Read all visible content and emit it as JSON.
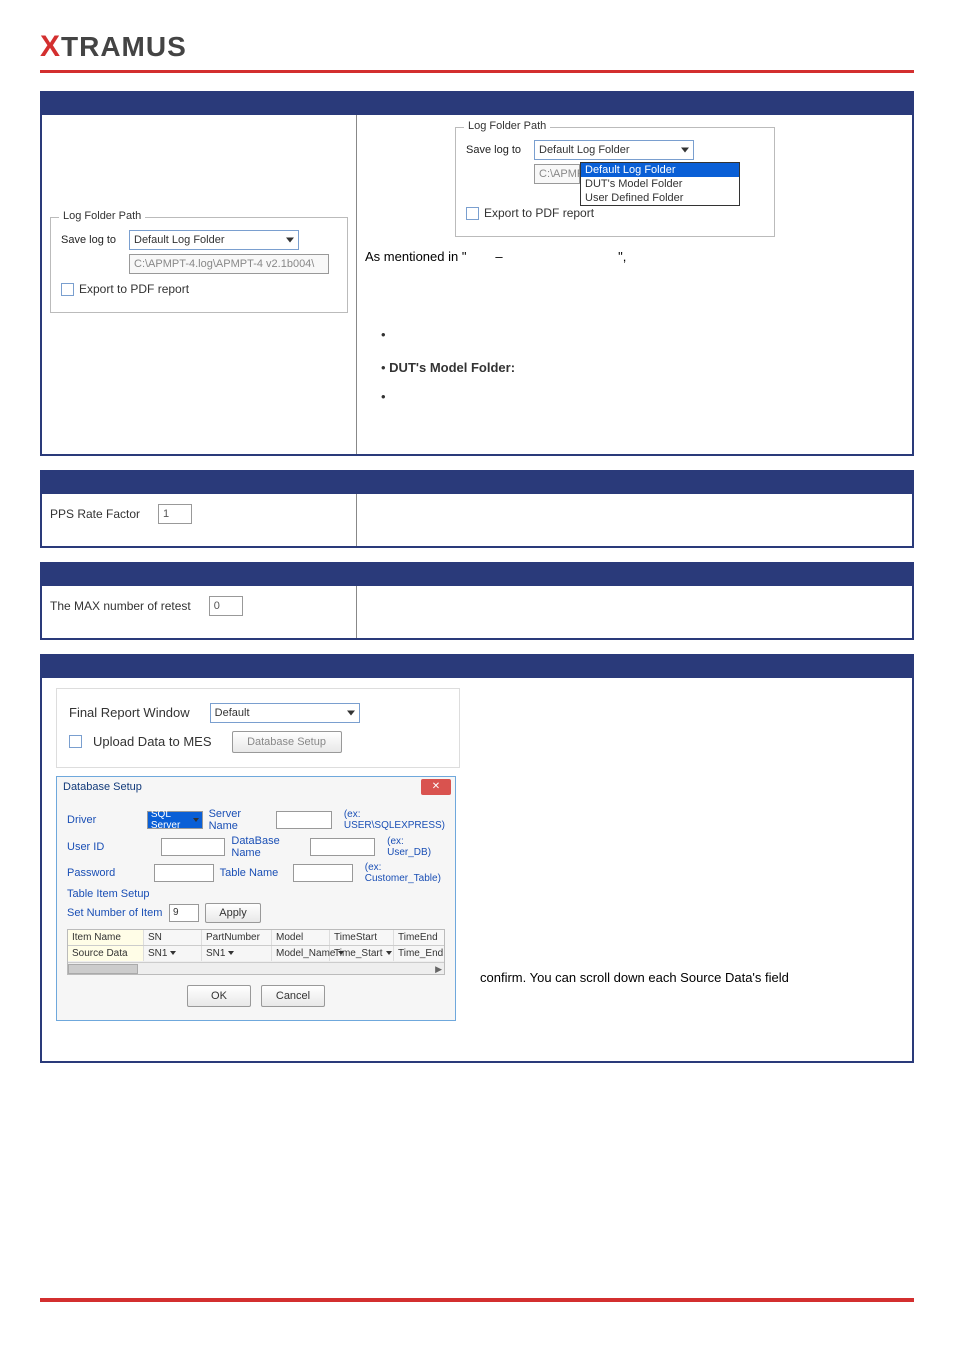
{
  "logo": {
    "x": "X",
    "rest": "TRAMUS"
  },
  "section1": {
    "right_small": {
      "group_title": "Log Folder Path",
      "save_label": "Save log to",
      "select_value": "Default Log Folder",
      "path_prefix": "C:\\APMP",
      "export_label": "Export to PDF report",
      "options": [
        "Default Log Folder",
        "DUT's Model Folder",
        "User Defined Folder"
      ],
      "selected_option": "Default Log Folder"
    },
    "right_text": {
      "line1_a": "As mentioned in \"",
      "line1_dash": "–",
      "line1_end": "\","
    },
    "left": {
      "group_title": "Log Folder Path",
      "save_label": "Save log to",
      "select_value": "Default Log Folder",
      "path_value": "C:\\APMPT-4.log\\APMPT-4 v2.1b004\\",
      "export_label": "Export to PDF report"
    },
    "bullets": {
      "dut": "DUT's Model Folder:"
    }
  },
  "section2": {
    "label": "PPS Rate Factor",
    "value": "1"
  },
  "section3": {
    "label": "The MAX number of retest",
    "value": "0"
  },
  "section4": {
    "top": {
      "final_label": "Final Report Window",
      "final_value": "Default",
      "upload_label": "Upload Data to MES",
      "db_btn": "Database Setup"
    },
    "dlg": {
      "title": "Database Setup",
      "driver_lbl": "Driver",
      "driver_val": "SQL Server",
      "server_lbl": "Server Name",
      "server_hint": "(ex: USER\\SQLEXPRESS)",
      "user_lbl": "User ID",
      "dbname_lbl": "DataBase Name",
      "dbname_hint": "(ex: User_DB)",
      "pwd_lbl": "Password",
      "table_lbl": "Table Name",
      "table_hint": "(ex: Customer_Table)",
      "tis_lbl": "Table Item Setup",
      "setnum_lbl": "Set Number of Item",
      "setnum_val": "9",
      "apply_btn": "Apply",
      "col_item": "Item Name",
      "col_src": "Source Data",
      "c1": "SN",
      "c1s": "SN1",
      "c2": "PartNumber",
      "c2s": "SN1",
      "c3": "Model",
      "c3s": "Model_Name",
      "c4": "TimeStart",
      "c4s": "Time_Start",
      "c5": "TimeEnd",
      "c5s": "Time_End",
      "ok": "OK",
      "cancel": "Cancel"
    },
    "right_text": "confirm. You can scroll down each Source Data's field"
  }
}
